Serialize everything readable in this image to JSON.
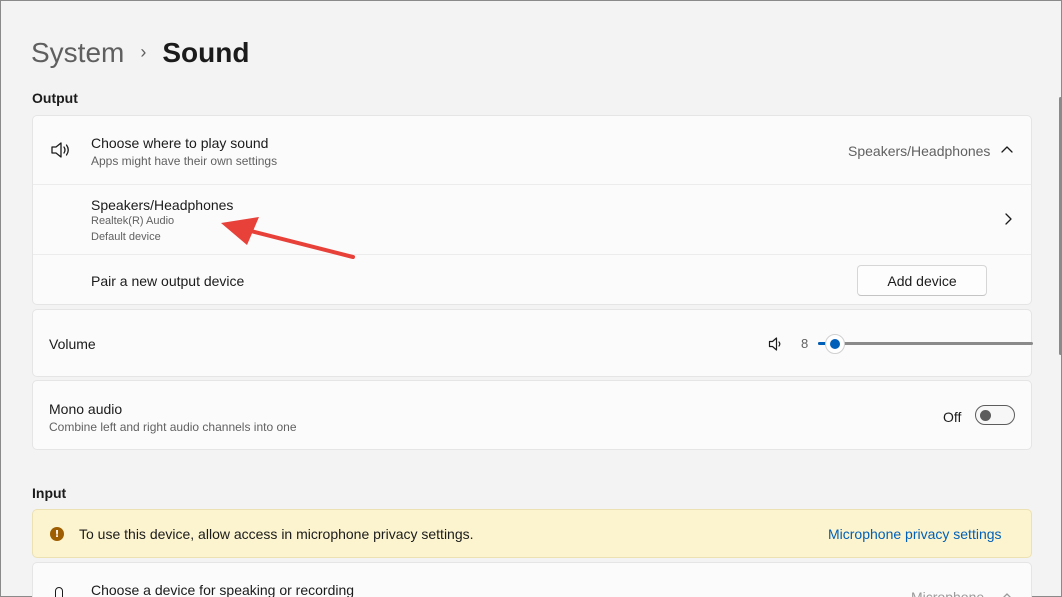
{
  "breadcrumb": {
    "parent": "System",
    "separator": "›",
    "current": "Sound"
  },
  "output": {
    "section_label": "Output",
    "choose": {
      "title": "Choose where to play sound",
      "subtitle": "Apps might have their own settings",
      "value": "Speakers/Headphones",
      "icon": "speaker-icon",
      "expanded": true
    },
    "device": {
      "name": "Speakers/Headphones",
      "driver": "Realtek(R) Audio",
      "status": "Default device"
    },
    "pair": {
      "label": "Pair a new output device",
      "button": "Add device"
    }
  },
  "volume": {
    "label": "Volume",
    "value": "8",
    "level": 0.08,
    "icon": "volume-icon"
  },
  "mono": {
    "title": "Mono audio",
    "subtitle": "Combine left and right audio channels into one",
    "state": "Off",
    "on": false
  },
  "input": {
    "section_label": "Input",
    "notice": {
      "text": "To use this device, allow access in microphone privacy settings.",
      "link": "Microphone privacy settings",
      "icon": "warning-icon"
    },
    "choose": {
      "title": "Choose a device for speaking or recording",
      "value": "Microphone"
    }
  },
  "colors": {
    "accent": "#005fb8",
    "annotation_arrow": "#e8413a",
    "notice_bg": "#fcf4ce"
  }
}
